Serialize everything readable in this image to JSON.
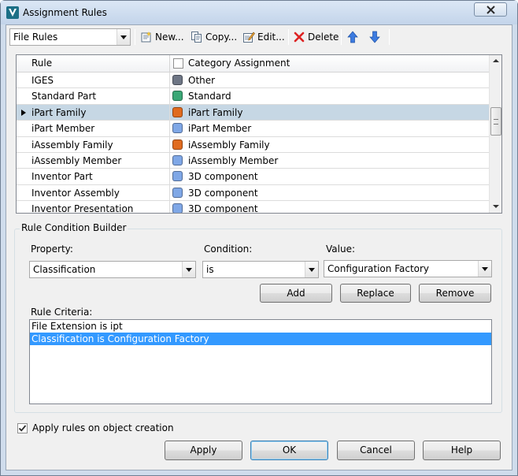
{
  "window": {
    "title": "Assignment Rules"
  },
  "toolbar": {
    "rules_type": "File Rules",
    "new_label": "New...",
    "copy_label": "Copy...",
    "edit_label": "Edit...",
    "delete_label": "Delete"
  },
  "grid": {
    "headers": {
      "rule": "Rule",
      "category": "Category Assignment"
    },
    "rows": [
      {
        "rule": "IGES",
        "category": "Other",
        "color": "#6e7685"
      },
      {
        "rule": "Standard Part",
        "category": "Standard",
        "color": "#3aa776"
      },
      {
        "rule": "iPart Family",
        "category": "iPart Family",
        "color": "#e06b1f"
      },
      {
        "rule": "iPart Member",
        "category": "iPart Member",
        "color": "#7fa7e6"
      },
      {
        "rule": "iAssembly Family",
        "category": "iAssembly Family",
        "color": "#e06b1f"
      },
      {
        "rule": "iAssembly Member",
        "category": "iAssembly Member",
        "color": "#7fa7e6"
      },
      {
        "rule": "Inventor Part",
        "category": "3D component",
        "color": "#7fa7e6"
      },
      {
        "rule": "Inventor Assembly",
        "category": "3D component",
        "color": "#7fa7e6"
      },
      {
        "rule": "Inventor Presentation",
        "category": "3D component",
        "color": "#7fa7e6"
      }
    ],
    "selected_index": 2
  },
  "builder": {
    "title": "Rule Condition Builder",
    "property_label": "Property:",
    "property_value": "Classification",
    "condition_label": "Condition:",
    "condition_value": "is",
    "value_label": "Value:",
    "value_value": "Configuration Factory",
    "add_label": "Add",
    "replace_label": "Replace",
    "remove_label": "Remove",
    "criteria_label": "Rule Criteria:",
    "criteria": [
      "File Extension is ipt",
      "Classification is Configuration Factory"
    ]
  },
  "footer": {
    "apply_on_creation_label": "Apply rules on object creation",
    "apply_on_creation_checked": true,
    "apply_label": "Apply",
    "ok_label": "OK",
    "cancel_label": "Cancel",
    "help_label": "Help"
  }
}
